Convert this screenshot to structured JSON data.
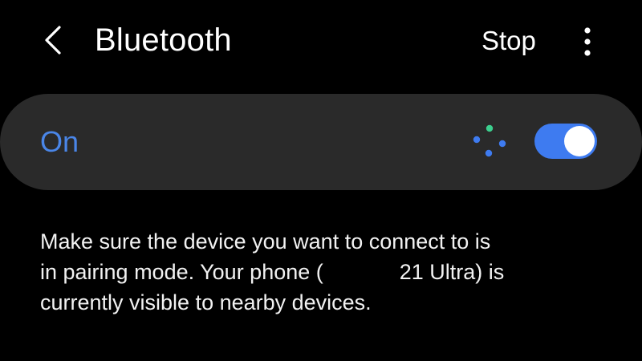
{
  "header": {
    "back_icon": "chevron-left-icon",
    "title": "Bluetooth",
    "stop_label": "Stop",
    "more_icon": "more-vertical-icon"
  },
  "toggle": {
    "label": "On",
    "state": true,
    "scan_icon": "scanning-dots-icon"
  },
  "description": {
    "line1": "Make sure the device you want to connect to is",
    "line2_before": "in pairing mode. Your phone (",
    "line2_after": "21 Ultra) is",
    "line3": "currently visible to nearby devices."
  },
  "colors": {
    "background": "#000000",
    "card": "#2a2a2a",
    "accent": "#3e7bf0",
    "label_on": "#4a86e8",
    "scan_green": "#3ccf8e",
    "text": "#ffffff"
  }
}
